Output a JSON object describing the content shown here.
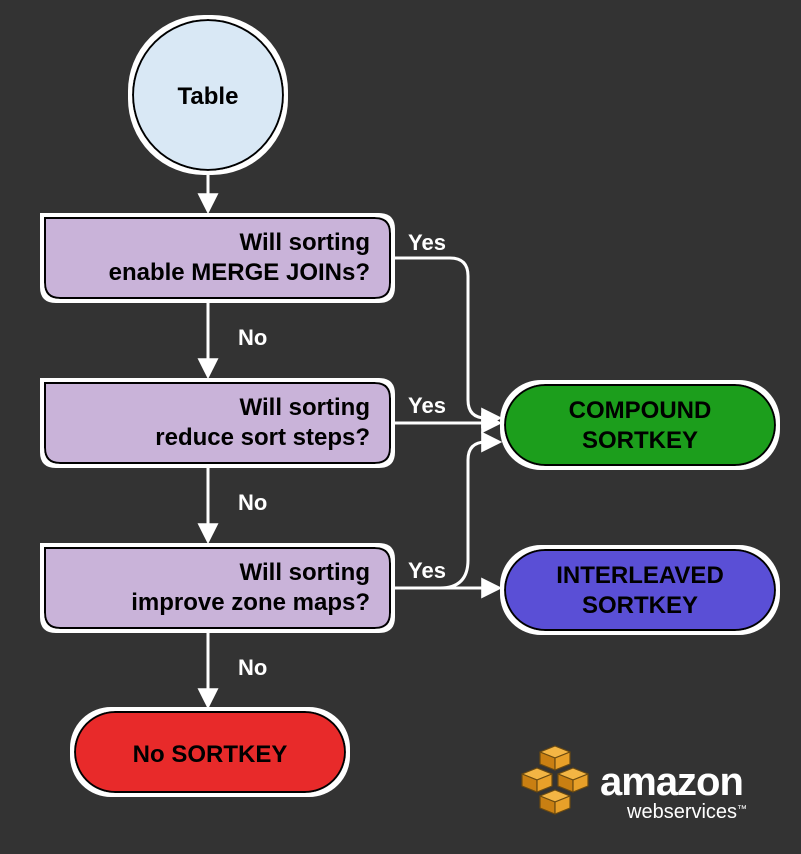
{
  "nodes": {
    "start": {
      "label": "Table"
    },
    "q1": {
      "line1": "Will sorting",
      "line2": "enable MERGE JOINs?"
    },
    "q2": {
      "line1": "Will sorting",
      "line2": "reduce sort steps?"
    },
    "q3": {
      "line1": "Will sorting",
      "line2": "improve zone maps?"
    },
    "out_compound": {
      "line1": "COMPOUND",
      "line2": "SORTKEY"
    },
    "out_interleaved": {
      "line1": "INTERLEAVED",
      "line2": "SORTKEY"
    },
    "out_none": {
      "label": "No SORTKEY"
    }
  },
  "labels": {
    "yes": "Yes",
    "no": "No"
  },
  "brand": {
    "main": "amazon",
    "sub": "webservices",
    "tm": "™"
  },
  "colors": {
    "start_fill": "#d9e8f5",
    "decision_fill": "#c9b3d9",
    "compound_fill": "#1a9e1a",
    "interleaved_fill": "#5a4fd6",
    "none_fill": "#e82c2c",
    "line": "#ffffff",
    "shape_stroke": "#000000",
    "halo": "#ffffff",
    "cube": "#f0a020"
  }
}
